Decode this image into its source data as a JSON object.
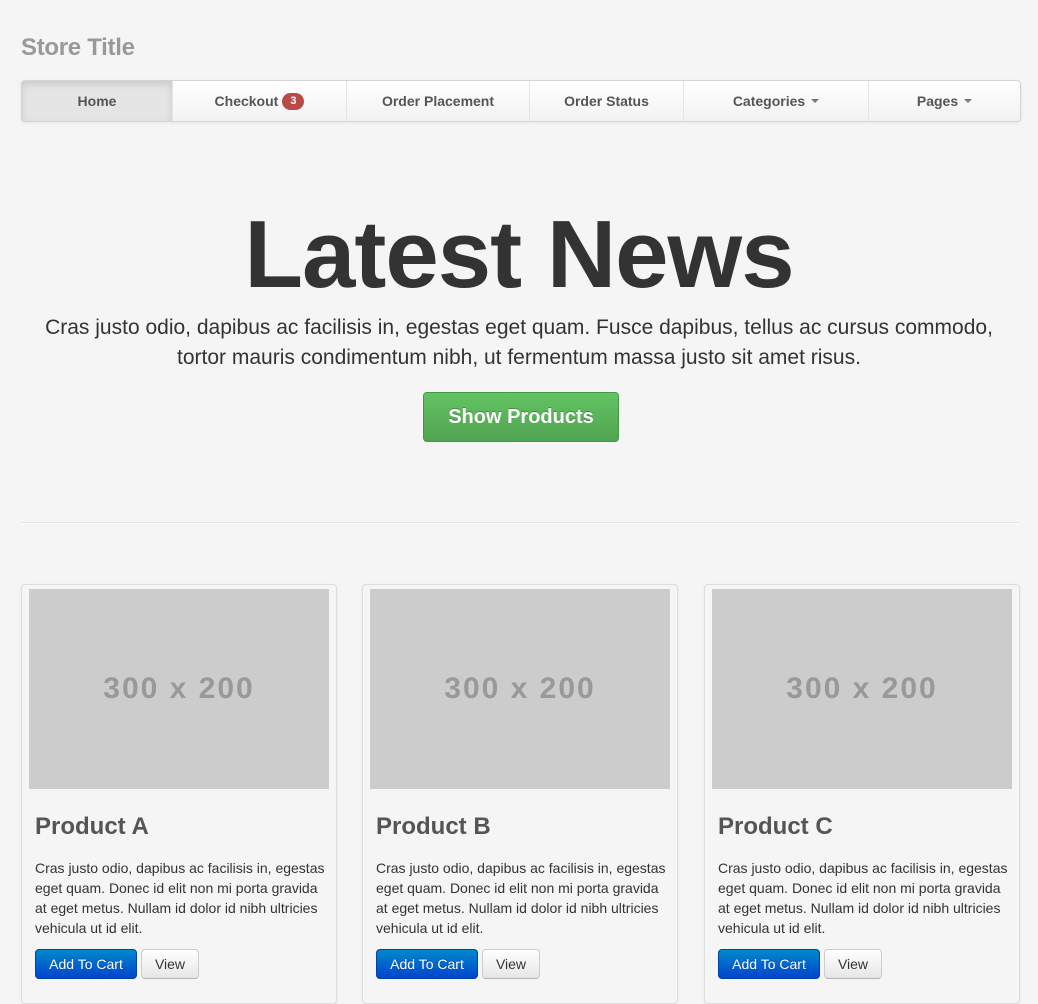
{
  "header": {
    "store_title": "Store Title"
  },
  "nav": {
    "items": [
      {
        "label": "Home"
      },
      {
        "label": "Checkout",
        "badge": "3"
      },
      {
        "label": "Order Placement"
      },
      {
        "label": "Order Status"
      },
      {
        "label": "Categories"
      },
      {
        "label": "Pages"
      }
    ]
  },
  "hero": {
    "title": "Latest News",
    "text": "Cras justo odio, dapibus ac facilisis in, egestas eget quam. Fusce dapibus, tellus ac cursus commodo, tortor mauris condimentum nibh, ut fermentum massa justo sit amet risus.",
    "button_label": "Show Products"
  },
  "products": [
    {
      "image_placeholder": "300 x 200",
      "name": "Product A",
      "description": "Cras justo odio, dapibus ac facilisis in, egestas eget quam. Donec id elit non mi porta gravida at eget metus. Nullam id dolor id nibh ultricies vehicula ut id elit.",
      "add_to_cart_label": "Add To Cart",
      "view_label": "View"
    },
    {
      "image_placeholder": "300 x 200",
      "name": "Product B",
      "description": "Cras justo odio, dapibus ac facilisis in, egestas eget quam. Donec id elit non mi porta gravida at eget metus. Nullam id dolor id nibh ultricies vehicula ut id elit.",
      "add_to_cart_label": "Add To Cart",
      "view_label": "View"
    },
    {
      "image_placeholder": "300 x 200",
      "name": "Product C",
      "description": "Cras justo odio, dapibus ac facilisis in, egestas eget quam. Donec id elit non mi porta gravida at eget metus. Nullam id dolor id nibh ultricies vehicula ut id elit.",
      "add_to_cart_label": "Add To Cart",
      "view_label": "View"
    }
  ],
  "colors": {
    "page_background": "#f5f5f5",
    "success_button": "#51a351",
    "primary_button": "#0044cc",
    "badge_important": "#b94a48",
    "image_placeholder": "#cccccc"
  }
}
